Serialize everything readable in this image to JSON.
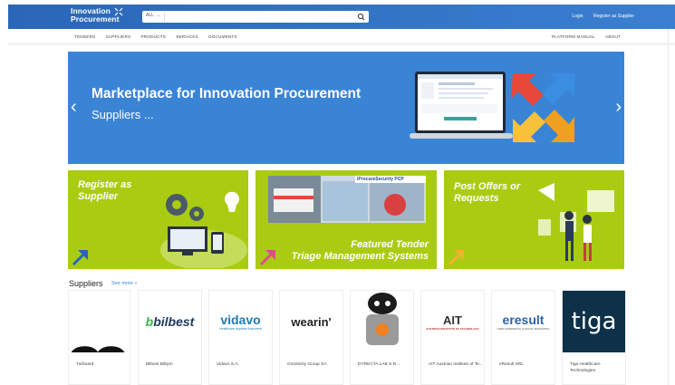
{
  "header": {
    "logo_line1": "Innovation",
    "logo_line2": "Procurement",
    "search": {
      "category": "ALL",
      "placeholder": ""
    },
    "links": [
      "Login",
      "Register as Supplier"
    ]
  },
  "nav": {
    "left": [
      "TENDERS",
      "SUPPLIERS",
      "PRODUCTS",
      "SERVICES",
      "DOCUMENTS"
    ],
    "right": [
      "PLATFORM MANUAL",
      "ABOUT"
    ]
  },
  "hero": {
    "title": "Marketplace for Innovation Procurement",
    "subtitle": "Suppliers ...",
    "slides": 5,
    "active_slide": 1
  },
  "tiles": [
    {
      "line1": "Register as",
      "line2": "Supplier"
    },
    {
      "banner": "iProcureSecurity PCP",
      "line1": "Featured Tender",
      "line2": "Triage Management Systems"
    },
    {
      "line1": "Post Offers or",
      "line2": "Requests"
    }
  ],
  "suppliers": {
    "heading": "Suppliers",
    "see_more": "See more »",
    "items": [
      {
        "name": "Turboard",
        "logo": ""
      },
      {
        "name": "Bilbest Bilişim",
        "logo": "bilbest",
        "logo_prefix": "b"
      },
      {
        "name": "Vidavo S.A.",
        "logo": "vidavo",
        "logo_tag": "Healthcare Anytime Anywhere"
      },
      {
        "name": "Gnosticity Group SA",
        "logo": "wearin'"
      },
      {
        "name": "DYRECTA LAB S.R....",
        "logo": "robot"
      },
      {
        "name": "AIT Austrian Institute of Te...",
        "logo": "AIT",
        "logo_tag": "AUSTRIAN INSTITUTE OF TECHNOLOGY"
      },
      {
        "name": "eResult SRL",
        "logo": "eresult",
        "logo_tag": "USER EXPERIENCE & DIGITAL MARKETING"
      },
      {
        "name": "Tiga Healthcare Technologies",
        "logo": "tiga"
      }
    ]
  },
  "colors": {
    "header_blue": "#2b66b8",
    "hero_blue": "#3a84d6",
    "tile_green": "#a9cc12",
    "link_blue": "#3b7fd0",
    "tiga_bg": "#0d3148"
  }
}
